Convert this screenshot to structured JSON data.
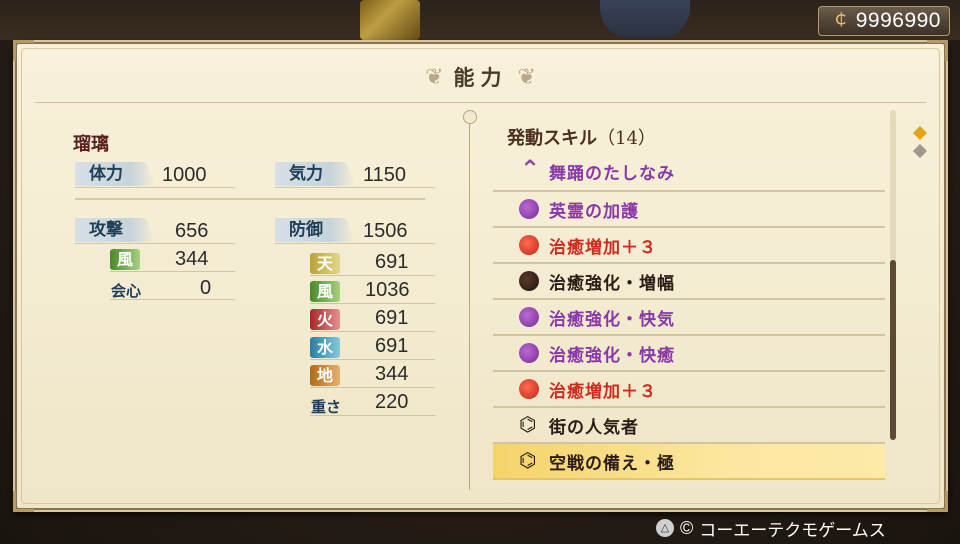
{
  "header": {
    "gold": "9996990",
    "coin_icon": "coin-icon"
  },
  "panel": {
    "title": "能力"
  },
  "character": {
    "name": "瑠璃"
  },
  "stats": {
    "hp_label": "体力",
    "hp_value": "1000",
    "ki_label": "気力",
    "ki_value": "1150",
    "attack_label": "攻撃",
    "attack_value": "656",
    "attack_element_label": "風",
    "attack_element_value": "344",
    "crit_label": "会心",
    "crit_value": "0",
    "defense_label": "防御",
    "defense_value": "1506",
    "resistances": [
      {
        "label": "天",
        "value": "691",
        "color": "#b8a23a"
      },
      {
        "label": "風",
        "value": "1036",
        "color": "#4a8a2a"
      },
      {
        "label": "火",
        "value": "691",
        "color": "#a6282a"
      },
      {
        "label": "水",
        "value": "691",
        "color": "#2a7ea0"
      },
      {
        "label": "地",
        "value": "344",
        "color": "#b06a1a"
      }
    ],
    "weight_label": "重さ",
    "weight_value": "220"
  },
  "skills": {
    "header_label": "発動スキル",
    "count": "（14）",
    "items": [
      {
        "name": "舞踊のたしなみ",
        "icon": "dance-icon",
        "color": "#8a38a8"
      },
      {
        "name": "英霊の加護",
        "icon": "purple-orb-icon",
        "color": "#8a38a8"
      },
      {
        "name": "治癒増加＋３",
        "icon": "red-orb-icon",
        "color": "#d02a1e"
      },
      {
        "name": "治癒強化・増幅",
        "icon": "dark-orb-icon",
        "color": "#2a1c14"
      },
      {
        "name": "治癒強化・快気",
        "icon": "purple-orb-icon",
        "color": "#8a38a8"
      },
      {
        "name": "治癒強化・快癒",
        "icon": "purple-orb-icon",
        "color": "#8a38a8"
      },
      {
        "name": "治癒増加＋３",
        "icon": "red-orb-icon",
        "color": "#d02a1e"
      },
      {
        "name": "街の人気者",
        "icon": "tomoe-icon",
        "color": "#2a1c14"
      },
      {
        "name": "空戦の備え・極",
        "icon": "tomoe-icon",
        "color": "#2a1c14",
        "selected": true
      }
    ]
  },
  "footer": {
    "button_glyph": "△",
    "copyright": "コーエーテクモゲームス",
    "copyright_symbol": "©"
  }
}
